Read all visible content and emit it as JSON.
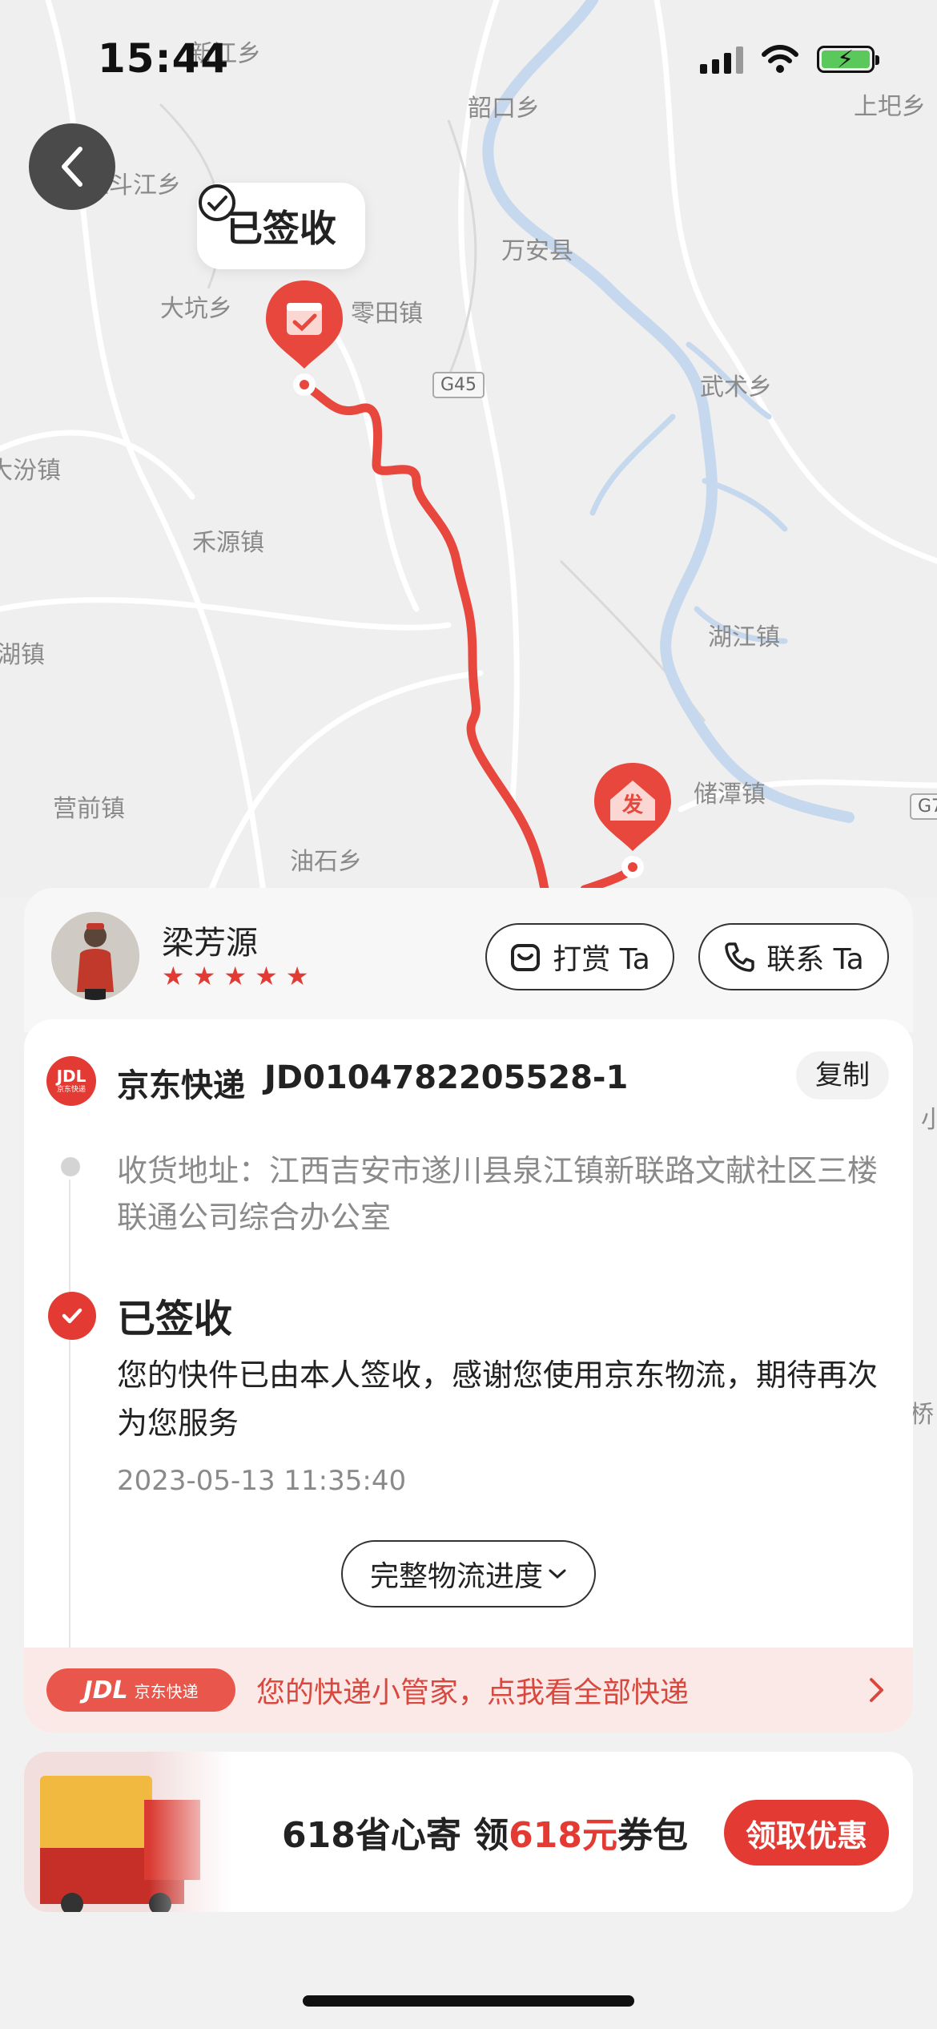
{
  "status_bar": {
    "time": "15:44"
  },
  "map": {
    "places": [
      "新江乡",
      "韶口乡",
      "上圯乡",
      "五斗江乡",
      "万安县",
      "大坑乡",
      "零田镇",
      "G45",
      "武术乡",
      "大汾镇",
      "禾源镇",
      "湖江镇",
      "湖镇",
      "储潭镇",
      "营前镇",
      "油石乡",
      "G7",
      "小",
      "桥"
    ],
    "signed_label": "已签收",
    "origin_label": "发"
  },
  "courier": {
    "name": "梁芳源",
    "rating": 5,
    "tip_label": "打赏 Ta",
    "contact_label": "联系 Ta"
  },
  "shipment": {
    "carrier": "京东快递",
    "tracking_no": "JD0104782205528-1",
    "copy_label": "复制",
    "logo_text": "JDL",
    "logo_sub": "京东快递",
    "address": "收货地址：江西吉安市遂川县泉江镇新联路文献社区三楼联通公司综合办公室",
    "status_title": "已签收",
    "status_desc": "您的快件已由本人签收，感谢您使用京东物流，期待再次为您服务",
    "status_time": "2023-05-13 11:35:40",
    "full_progress_label": "完整物流进度"
  },
  "promo": {
    "badge_main": "JDL",
    "badge_sub": "京东快递",
    "text": "您的快递小管家，点我看全部快递"
  },
  "coupon": {
    "text_a": "618省心寄 领",
    "text_red": "618元",
    "text_b": "券包",
    "button": "领取优惠"
  },
  "colors": {
    "accent": "#e33b33",
    "route": "#e8473d",
    "water": "#c6d8ee"
  }
}
